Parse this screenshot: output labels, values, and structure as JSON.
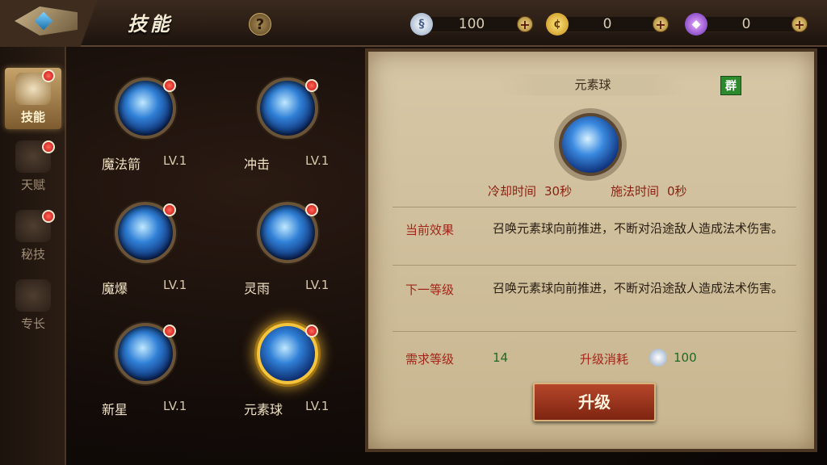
{
  "header": {
    "title": "技能",
    "help": "?",
    "currencies": [
      {
        "icon": "silver-coin-icon",
        "value": "100"
      },
      {
        "icon": "gold-coin-icon",
        "value": "0"
      },
      {
        "icon": "purple-gem-icon",
        "value": "0"
      }
    ],
    "plus": "+"
  },
  "sidenav": {
    "items": [
      {
        "label": "技能",
        "icon": "book-icon"
      },
      {
        "label": "天赋",
        "icon": "talent-icon"
      },
      {
        "label": "秘技",
        "icon": "secret-skill-icon"
      },
      {
        "label": "专长",
        "icon": "specialty-icon"
      }
    ]
  },
  "skills": [
    {
      "name": "魔法箭",
      "level": "LV.1"
    },
    {
      "name": "冲击",
      "level": "LV.1"
    },
    {
      "name": "魔爆",
      "level": "LV.1"
    },
    {
      "name": "灵雨",
      "level": "LV.1"
    },
    {
      "name": "新星",
      "level": "LV.1"
    },
    {
      "name": "元素球",
      "level": "LV.1"
    }
  ],
  "detail": {
    "name": "元素球",
    "tag": "群",
    "cooldown_label": "冷却时间",
    "cooldown_value": "30秒",
    "cast_label": "施法时间",
    "cast_value": "0秒",
    "current_effect_label": "当前效果",
    "current_effect_text": "召唤元素球向前推进，不断对沿途敌人造成法术伤害。",
    "next_level_label": "下一等级",
    "next_level_text": "召唤元素球向前推进，不断对沿途敌人造成法术伤害。",
    "req_level_label": "需求等级",
    "req_level_value": "14",
    "upgrade_cost_label": "升级消耗",
    "upgrade_cost_value": "100",
    "upgrade_button": "升级"
  },
  "colors": {
    "accent_red": "#a2261a",
    "accent_green": "#1f6a1f",
    "selected_glow": "#f4c53c"
  }
}
